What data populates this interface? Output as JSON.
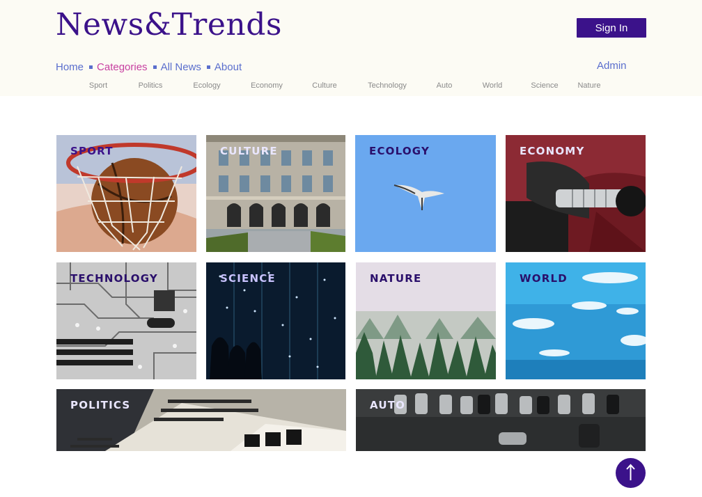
{
  "header": {
    "logo": "News&Trends",
    "signin_label": "Sign In",
    "nav": [
      "Home",
      "Categories",
      "All News",
      "About"
    ],
    "admin_label": "Admin",
    "subnav": [
      "Sport",
      "Politics",
      "Ecology",
      "Economy",
      "Culture",
      "Technology",
      "Auto",
      "World",
      "Science",
      "Nature"
    ]
  },
  "tiles": {
    "sport": "SPORT",
    "culture": "CULTURE",
    "ecology": "ECOLOGY",
    "economy": "ECONOMY",
    "technology": "TECHNOLOGY",
    "science": "SCIENCE",
    "nature": "NATURE",
    "world": "WORLD",
    "politics": "POLITICS",
    "auto": "AUTO"
  },
  "icons": {
    "scroll_top": "arrow-up-icon"
  },
  "colors": {
    "brand": "#3b128a",
    "nav_link": "#5a6ecd",
    "nav_active": "#c73fa0",
    "header_bg": "#fcfbf4"
  }
}
